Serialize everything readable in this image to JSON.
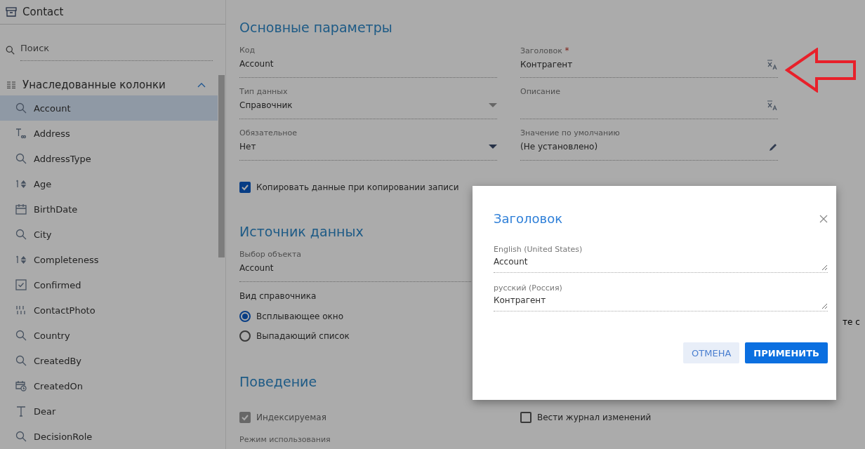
{
  "sidebar": {
    "title": "Contact",
    "search": {
      "placeholder": "Поиск"
    },
    "group": {
      "label": "Унаследованные колонки",
      "expanded": true
    },
    "items": [
      {
        "label": "Account",
        "kind": "lookup",
        "selected": true
      },
      {
        "label": "Address",
        "kind": "longtext",
        "selected": false
      },
      {
        "label": "AddressType",
        "kind": "lookup",
        "selected": false
      },
      {
        "label": "Age",
        "kind": "number",
        "selected": false
      },
      {
        "label": "BirthDate",
        "kind": "date",
        "selected": false
      },
      {
        "label": "City",
        "kind": "lookup",
        "selected": false
      },
      {
        "label": "Completeness",
        "kind": "number",
        "selected": false
      },
      {
        "label": "Confirmed",
        "kind": "boolean",
        "selected": false
      },
      {
        "label": "ContactPhoto",
        "kind": "binary",
        "selected": false
      },
      {
        "label": "Country",
        "kind": "lookup",
        "selected": false
      },
      {
        "label": "CreatedBy",
        "kind": "lookup",
        "selected": false
      },
      {
        "label": "CreatedOn",
        "kind": "datetime",
        "selected": false
      },
      {
        "label": "Dear",
        "kind": "text",
        "selected": false
      },
      {
        "label": "DecisionRole",
        "kind": "lookup",
        "selected": false
      }
    ]
  },
  "main": {
    "basic": {
      "title": "Основные параметры",
      "fields": [
        {
          "label": "Код",
          "value": "Account",
          "kind": "text"
        },
        {
          "label": "Заголовок",
          "required_mark": "*",
          "value": "Контрагент",
          "kind": "translate"
        },
        {
          "label": "Тип данных",
          "value": "Справочник",
          "kind": "select",
          "disabled": true
        },
        {
          "label": "Описание",
          "kind": "translate"
        },
        {
          "label": "Обязательное",
          "value": "Нет",
          "kind": "select",
          "disabled": false
        },
        {
          "label": "Значение по умолчанию",
          "value": "(Не установлено)",
          "kind": "edit"
        }
      ],
      "copy_checkbox": {
        "label": "Копировать данные при копировании записи",
        "checked": true
      }
    },
    "source": {
      "title": "Источник данных",
      "object_field": {
        "label": "Выбор объекта",
        "value": "Account"
      },
      "lookup_view": {
        "label": "Вид справочника",
        "options": [
          {
            "label": "Всплывающее окно",
            "selected": true
          },
          {
            "label": "Выпадающий список",
            "selected": false
          }
        ]
      },
      "cut_text": "те с"
    },
    "behavior": {
      "title": "Поведение",
      "checkboxes": [
        {
          "label": "Индексируемая",
          "checked": true,
          "disabled": true
        },
        {
          "label": "Вести журнал изменений",
          "checked": false,
          "disabled": false
        }
      ],
      "usage_label": "Режим использования"
    }
  },
  "dialog": {
    "title": "Заголовок",
    "fields": [
      {
        "label": "English (United States)",
        "value": "Account"
      },
      {
        "label": "русский (Россия)",
        "value": "Контрагент"
      }
    ],
    "buttons": [
      {
        "label": "ОТМЕНА",
        "kind": "secondary"
      },
      {
        "label": "ПРИМЕНИТЬ",
        "kind": "primary"
      }
    ]
  }
}
